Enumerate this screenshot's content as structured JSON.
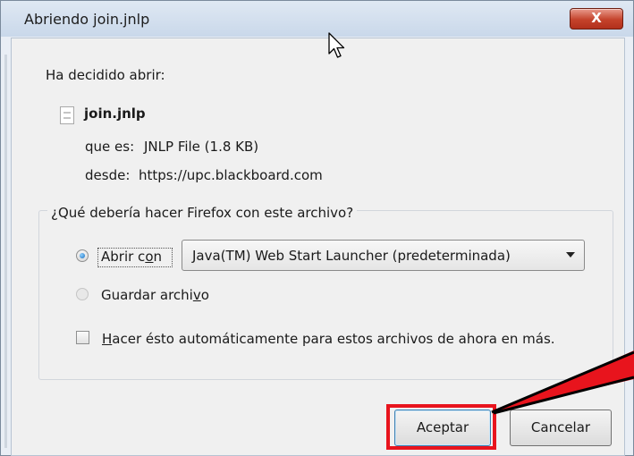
{
  "window": {
    "title": "Abriendo join.jnlp",
    "close_label": "X"
  },
  "dialog": {
    "decided_label": "Ha decidido abrir:",
    "file_name": "join.jnlp",
    "type_label": "que es:",
    "type_value": "JNLP File (1.8 KB)",
    "from_label": "desde:",
    "from_value": "https://upc.blackboard.com"
  },
  "action_group": {
    "question": "¿Qué debería hacer Firefox con este archivo?",
    "open_with": {
      "label_pre": "Abrir c",
      "label_accel": "o",
      "label_post": "n",
      "selected": true
    },
    "open_with_app": "Java(TM) Web Start Launcher (predeterminada)",
    "save": {
      "label_pre": "Guardar archi",
      "label_accel": "v",
      "label_post": "o",
      "selected": false
    },
    "auto": {
      "label_accel": "H",
      "label_post": "acer ésto automáticamente para estos archivos de ahora en más.",
      "checked": false
    }
  },
  "buttons": {
    "ok_label": "Aceptar",
    "cancel_label": "Cancelar"
  },
  "colors": {
    "highlight": "#e8141d",
    "arrow_black": "#000000",
    "arrow_red": "#e8141d"
  },
  "icons": {
    "file": "file-icon",
    "cursor": "mouse-pointer-icon",
    "dropdown": "chevron-down-icon"
  }
}
